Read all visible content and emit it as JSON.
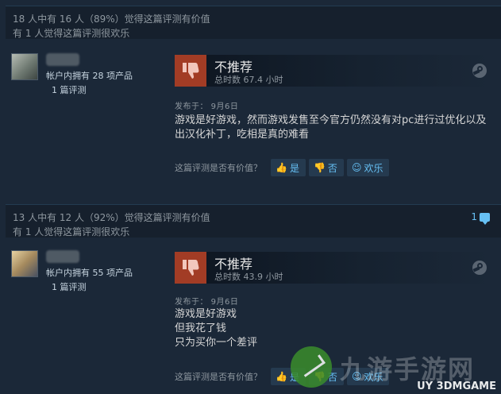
{
  "reviews": [
    {
      "helpful_line": "18 人中有 16 人（89%）觉得这篇评测有价值",
      "funny_line": "有 1 人觉得这篇评测很欢乐",
      "comments": "",
      "author": {
        "owned": "帐户内拥有 28 项产品",
        "review_count": "1 篇评测"
      },
      "verdict": "不推荐",
      "hours": "总时数 67.4 小时",
      "posted": "发布于： 9月6日",
      "body": [
        "游戏是好游戏，然而游戏发售至今官方仍然没有对pc进行过优化以及",
        "出汉化补丁，吃相是真的难看"
      ],
      "vote": {
        "question": "这篇评测是否有价值？",
        "yes": "是",
        "no": "否",
        "funny": "欢乐"
      }
    },
    {
      "helpful_line": "13 人中有 12 人（92%）觉得这篇评测有价值",
      "funny_line": "有 1 人觉得这篇评测很欢乐",
      "comments": "1",
      "author": {
        "owned": "帐户内拥有 55 项产品",
        "review_count": "1 篇评测"
      },
      "verdict": "不推荐",
      "hours": "总时数 43.9 小时",
      "posted": "发布于： 9月6日",
      "body": [
        "游戏是好游戏",
        "但我花了钱",
        "只为买你一个差评"
      ],
      "vote": {
        "question": "这篇评测是否有价值？",
        "yes": "是",
        "no": "否",
        "funny": "欢乐"
      }
    }
  ],
  "watermark": {
    "main": "九游手游网",
    "sub": "UY 3DMGAME"
  },
  "colors": {
    "background": "#1b2838",
    "thumb_down": "#a23c25",
    "link_blue": "#66c0f4"
  }
}
